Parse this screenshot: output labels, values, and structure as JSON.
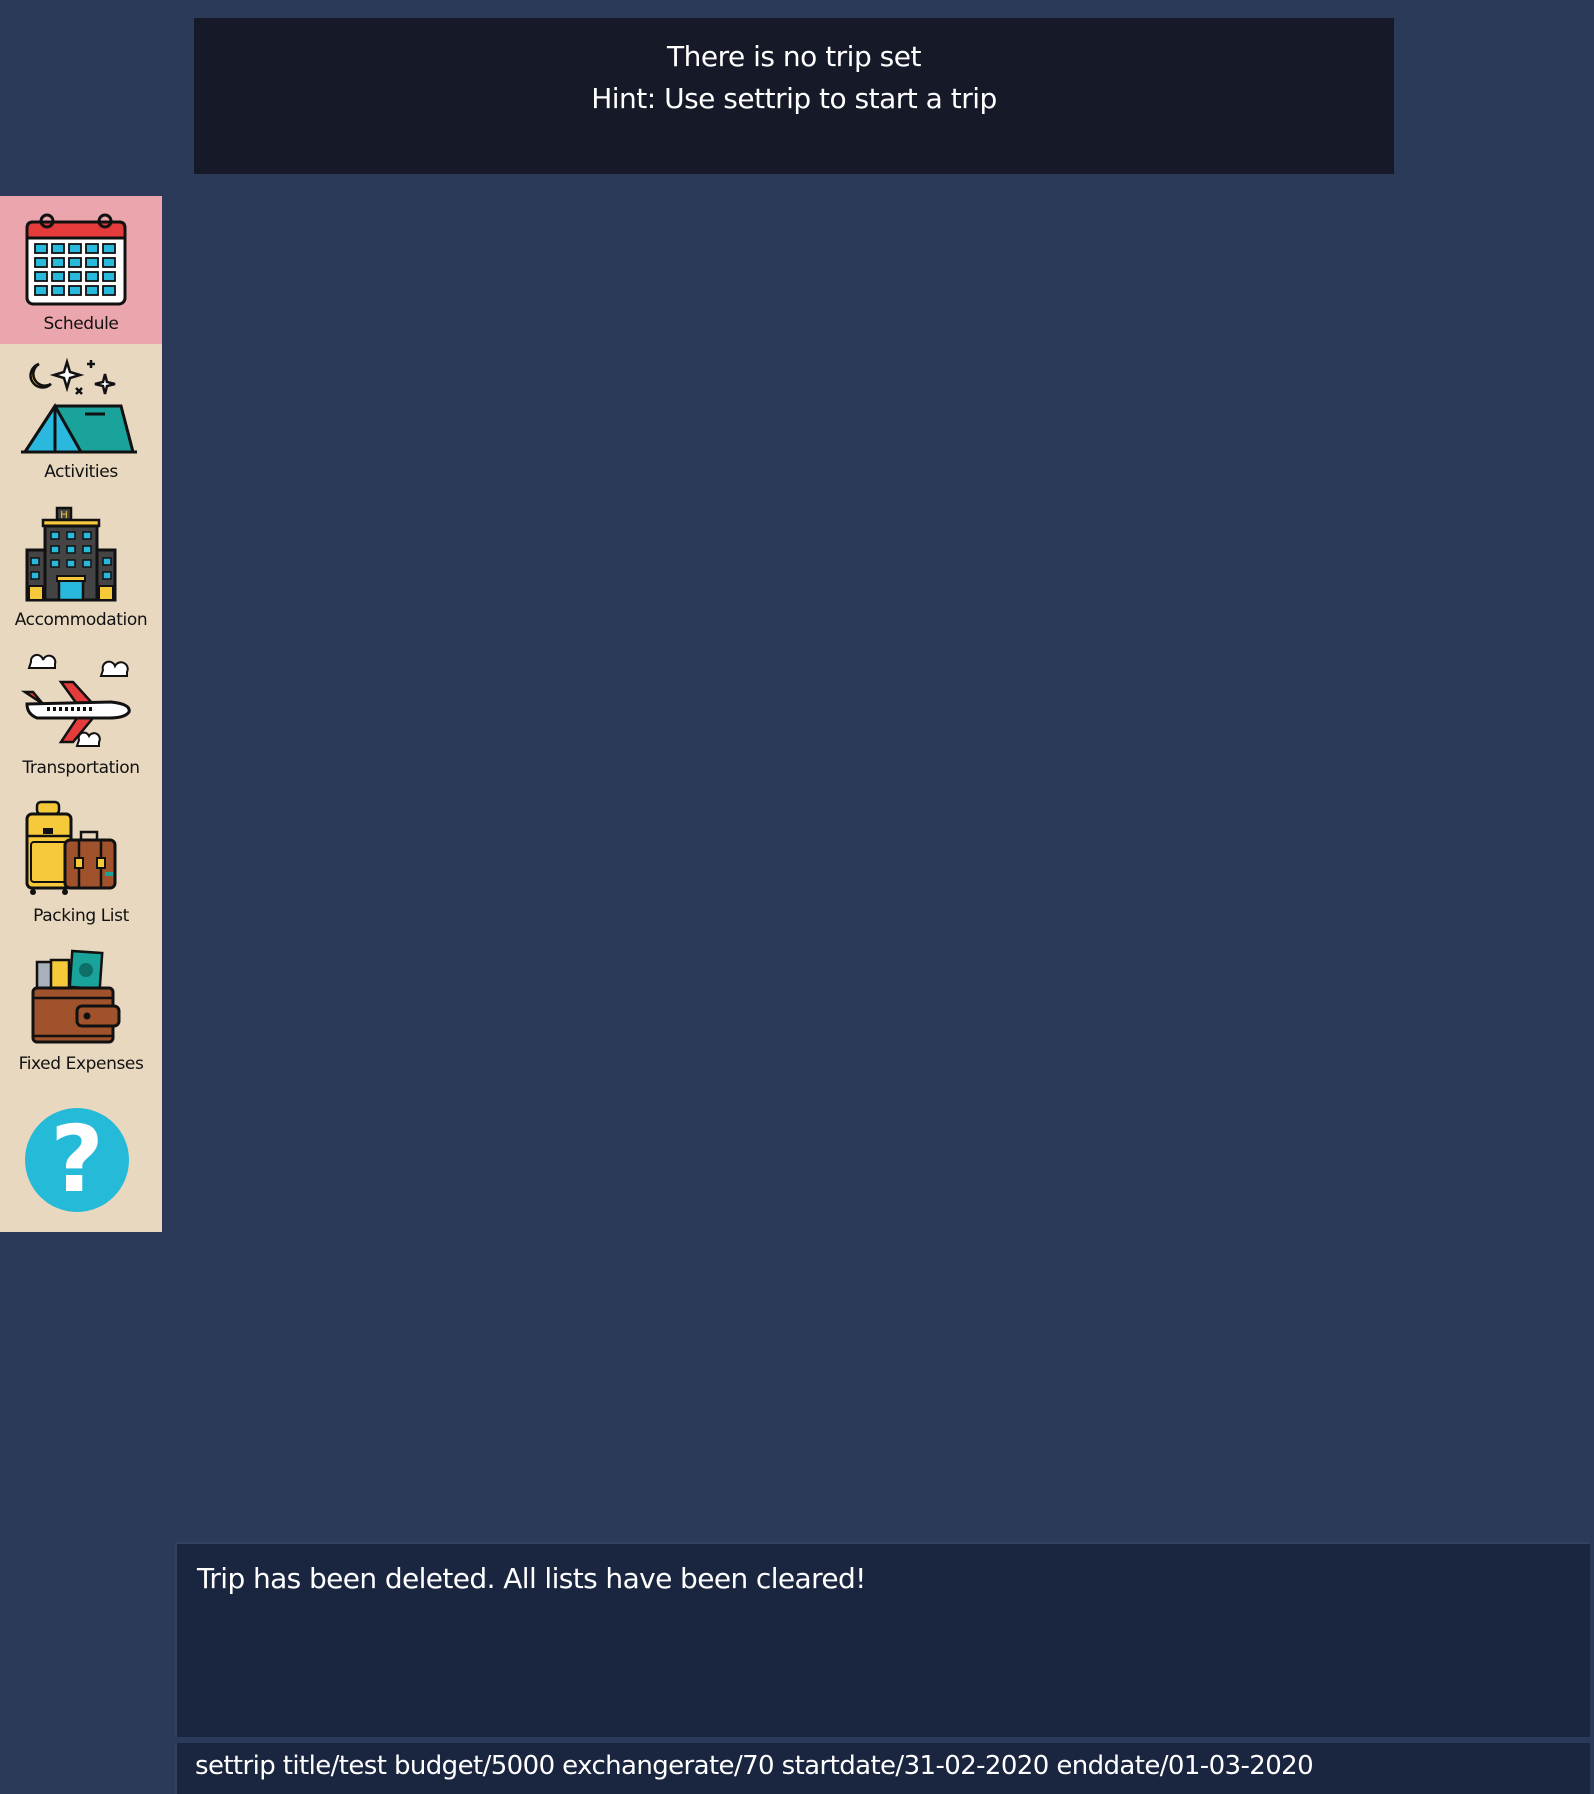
{
  "banner": {
    "line1": "There is no trip set",
    "line2": "Hint: Use settrip to start a trip"
  },
  "sidebar": {
    "items": [
      {
        "label": "Schedule",
        "icon": "calendar-icon",
        "active": true
      },
      {
        "label": "Activities",
        "icon": "tent-icon",
        "active": false
      },
      {
        "label": "Accommodation",
        "icon": "hotel-icon",
        "active": false
      },
      {
        "label": "Transportation",
        "icon": "airplane-icon",
        "active": false
      },
      {
        "label": "Packing List",
        "icon": "luggage-icon",
        "active": false
      },
      {
        "label": "Fixed Expenses",
        "icon": "wallet-icon",
        "active": false
      }
    ],
    "help_icon": "question-mark-icon",
    "help_glyph": "?"
  },
  "result": {
    "text": "Trip has been deleted. All lists have been cleared!"
  },
  "command": {
    "text": "settrip title/test budget/5000 exchangerate/70 startdate/31-02-2020 enddate/01-03-2020"
  },
  "colors": {
    "background": "#2a3a58",
    "banner_bg": "#161927",
    "sidebar_bg": "#e8d8bf",
    "active_item_bg": "#eba6ad",
    "help_button": "#26bad9",
    "result_bg": "#1a2540"
  }
}
